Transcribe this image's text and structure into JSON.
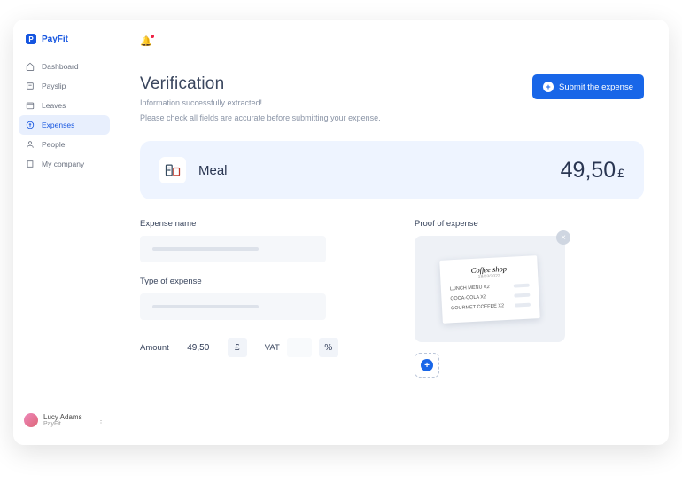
{
  "brand": {
    "name": "PayFit",
    "logo_letter": "P"
  },
  "sidebar": {
    "items": [
      {
        "label": "Dashboard",
        "icon": "home-icon"
      },
      {
        "label": "Payslip",
        "icon": "payslip-icon"
      },
      {
        "label": "Leaves",
        "icon": "calendar-icon"
      },
      {
        "label": "Expenses",
        "icon": "expenses-icon",
        "active": true
      },
      {
        "label": "People",
        "icon": "people-icon"
      },
      {
        "label": "My company",
        "icon": "company-icon"
      }
    ]
  },
  "user": {
    "name": "Lucy Adams",
    "subtitle": "PayFit"
  },
  "page": {
    "title": "Verification",
    "subtitle_line1": "Information successfully extracted!",
    "subtitle_line2": "Please check all fields are accurate before submitting your expense.",
    "submit_label": "Submit the expense"
  },
  "summary": {
    "category": "Meal",
    "amount": "49,50",
    "currency": "£"
  },
  "form": {
    "expense_name_label": "Expense name",
    "type_label": "Type of expense",
    "amount_label": "Amount",
    "amount_value": "49,50",
    "amount_currency": "£",
    "vat_label": "VAT",
    "vat_unit": "%",
    "proof_label": "Proof of expense"
  },
  "receipt": {
    "title": "Coffee shop",
    "date": "18/03/2022",
    "lines": [
      {
        "label": "LUNCH MENU X2"
      },
      {
        "label": "COCA-COLA X2"
      },
      {
        "label": "GOURMET COFFEE X2"
      }
    ]
  },
  "colors": {
    "accent": "#1866e8"
  }
}
